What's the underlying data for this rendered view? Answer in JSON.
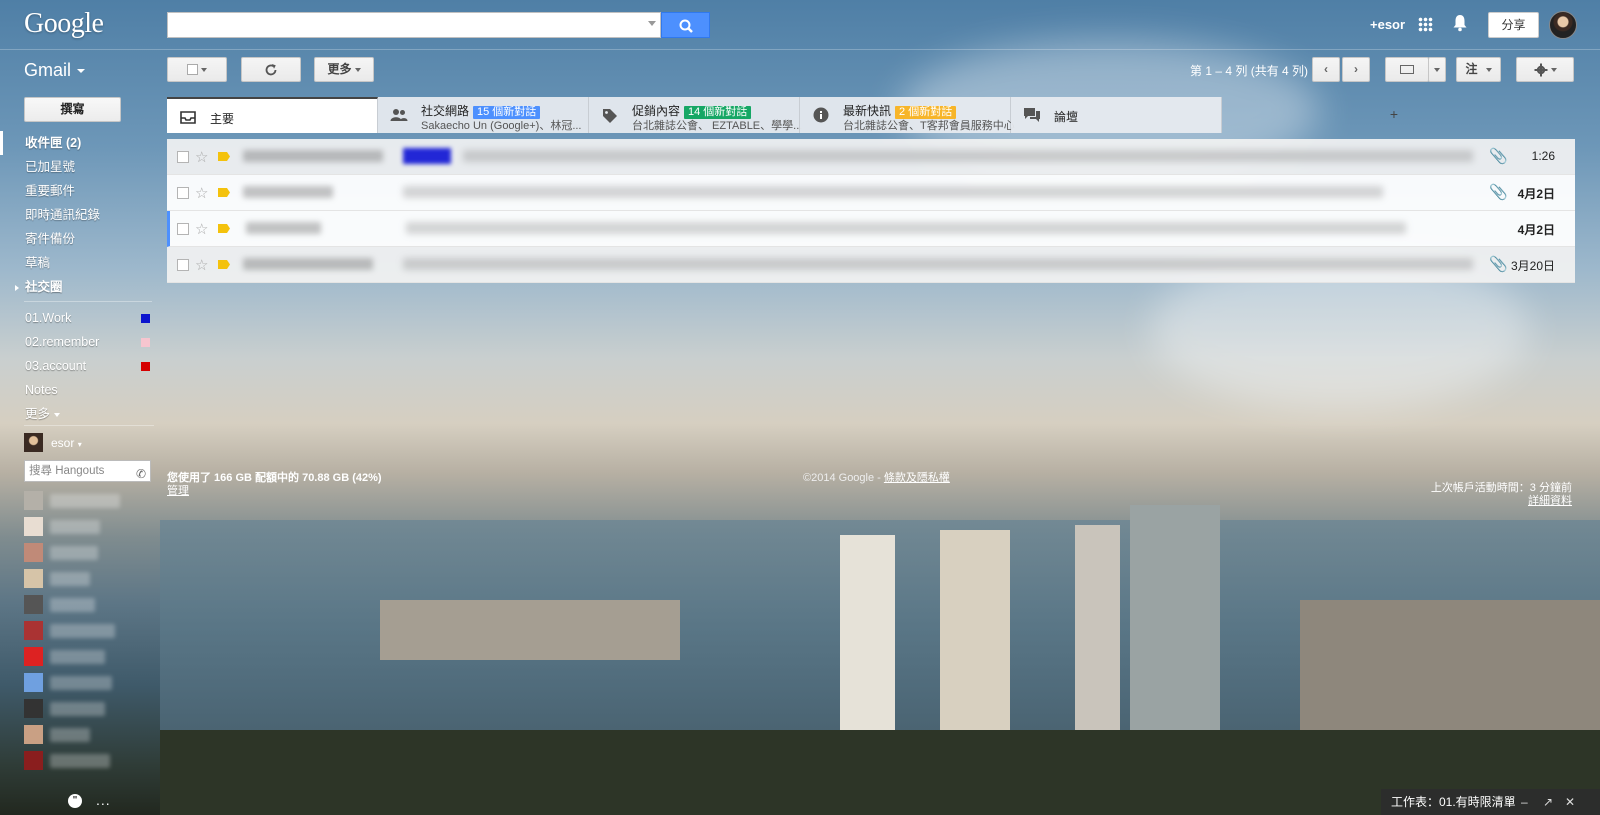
{
  "header": {
    "logo": "Google",
    "search_placeholder": "",
    "user_label": "+esor",
    "share_label": "分享"
  },
  "toolbar": {
    "app_label": "Gmail",
    "more_label": "更多",
    "pager": "第 1 – 4 列 (共有 4 列)",
    "lang_label": "注"
  },
  "nav": {
    "compose_label": "撰寫",
    "items": [
      {
        "label": "收件匣 (2)",
        "active": true
      },
      {
        "label": "已加星號"
      },
      {
        "label": "重要郵件"
      },
      {
        "label": "即時通訊紀錄"
      },
      {
        "label": "寄件備份"
      },
      {
        "label": "草稿"
      },
      {
        "label": "社交圈",
        "group": true
      },
      {
        "label": "01.Work",
        "color": "#0b14ce"
      },
      {
        "label": "02.remember",
        "color": "#f6c5cf"
      },
      {
        "label": "03.account",
        "color": "#d50000"
      },
      {
        "label": "Notes"
      },
      {
        "label": "更多"
      }
    ]
  },
  "hangouts": {
    "user": "esor",
    "search_placeholder": "搜尋 Hangouts"
  },
  "tabs": [
    {
      "label": "主要",
      "icon": "inbox-icon",
      "active": true
    },
    {
      "label": "社交網路",
      "badge": "15 個新對話",
      "badge_color": "#4d90fe",
      "sub": "Sakaecho Un (Google+)、林冠..."
    },
    {
      "label": "促銷內容",
      "badge": "14 個新對話",
      "badge_color": "#16a765",
      "sub": "台北雜誌公會、 EZTABLE、學學..."
    },
    {
      "label": "最新快訊",
      "badge": "2 個新對話",
      "badge_color": "#f7b529",
      "sub": "台北雜誌公會、T客邦會員服務中心"
    },
    {
      "label": "論壇",
      "icon": "forum-icon"
    }
  ],
  "emails": [
    {
      "date": "1:26",
      "unread": false,
      "clip": true
    },
    {
      "date": "4月2日",
      "unread": true,
      "clip": true
    },
    {
      "date": "4月2日",
      "unread": true,
      "clip": false
    },
    {
      "date": "3月20日",
      "unread": false,
      "clip": true
    }
  ],
  "footer": {
    "quota": "您使用了 166 GB 配額中的 70.88 GB (42%)",
    "manage": "管理",
    "copyright": "©2014 Google - ",
    "terms": "條款及隱私權",
    "last_activity": "上次帳戶活動時間：3 分鐘前",
    "details": "詳細資料"
  },
  "taskbar": {
    "label": "工作表：01.有時限清單"
  }
}
